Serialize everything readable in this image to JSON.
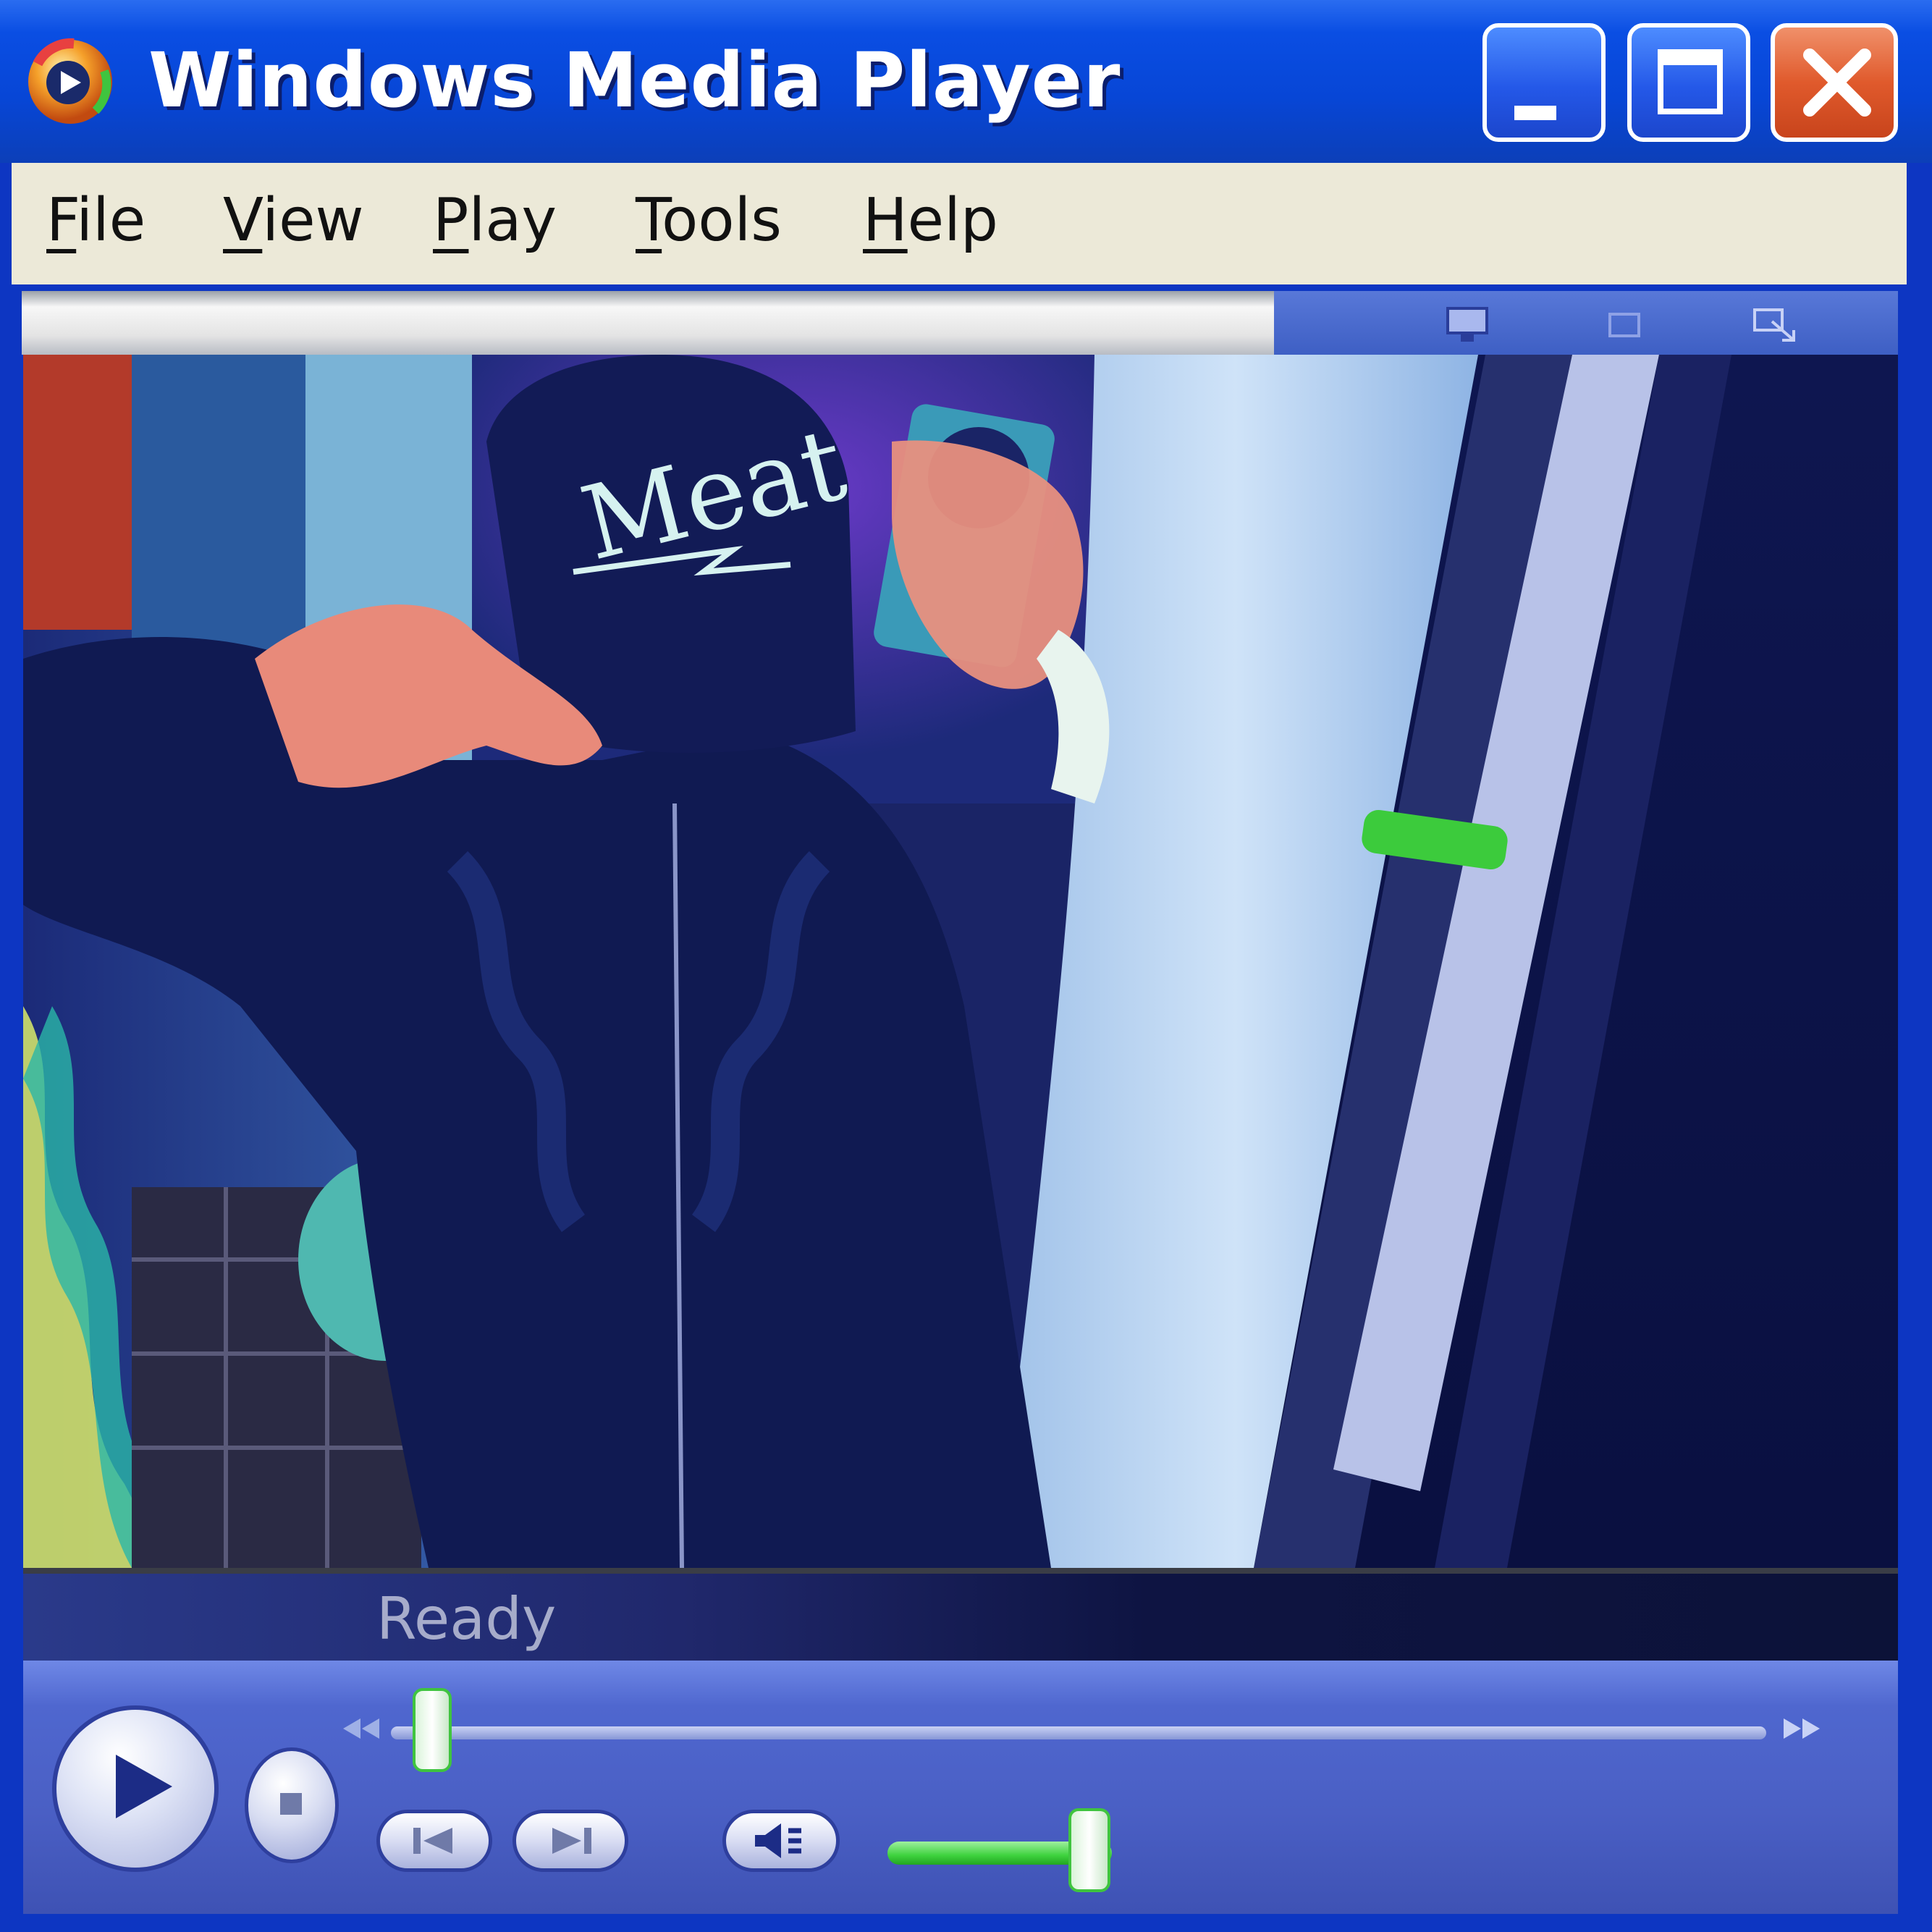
{
  "window": {
    "title": "Windows Media Player"
  },
  "menu": [
    {
      "label": "File",
      "key": "F",
      "rest": "ile"
    },
    {
      "label": "View",
      "key": "V",
      "rest": "iew"
    },
    {
      "label": "Play",
      "key": "P",
      "rest": "lay"
    },
    {
      "label": "Tools",
      "key": "T",
      "rest": "ools"
    },
    {
      "label": "Help",
      "key": "H",
      "rest": "elp"
    }
  ],
  "status": {
    "text": "Ready"
  },
  "playback": {
    "seek_position": 0.03,
    "volume": 0.9
  },
  "colors": {
    "title_bar": "#0746d6",
    "menu_bg": "#ece9d8",
    "close_button": "#e05a2c",
    "slider_green": "#3ed23e",
    "controls_bg": "#4a5fc4"
  },
  "icons": {
    "app": "wmp-logo-icon",
    "minimize": "minimize-icon",
    "maximize": "maximize-icon",
    "close": "close-icon",
    "play": "play-icon",
    "stop": "stop-icon",
    "previous": "previous-track-icon",
    "next": "next-track-icon",
    "mute": "speaker-icon",
    "rewind": "rewind-icon",
    "fast_forward": "fast-forward-icon"
  }
}
